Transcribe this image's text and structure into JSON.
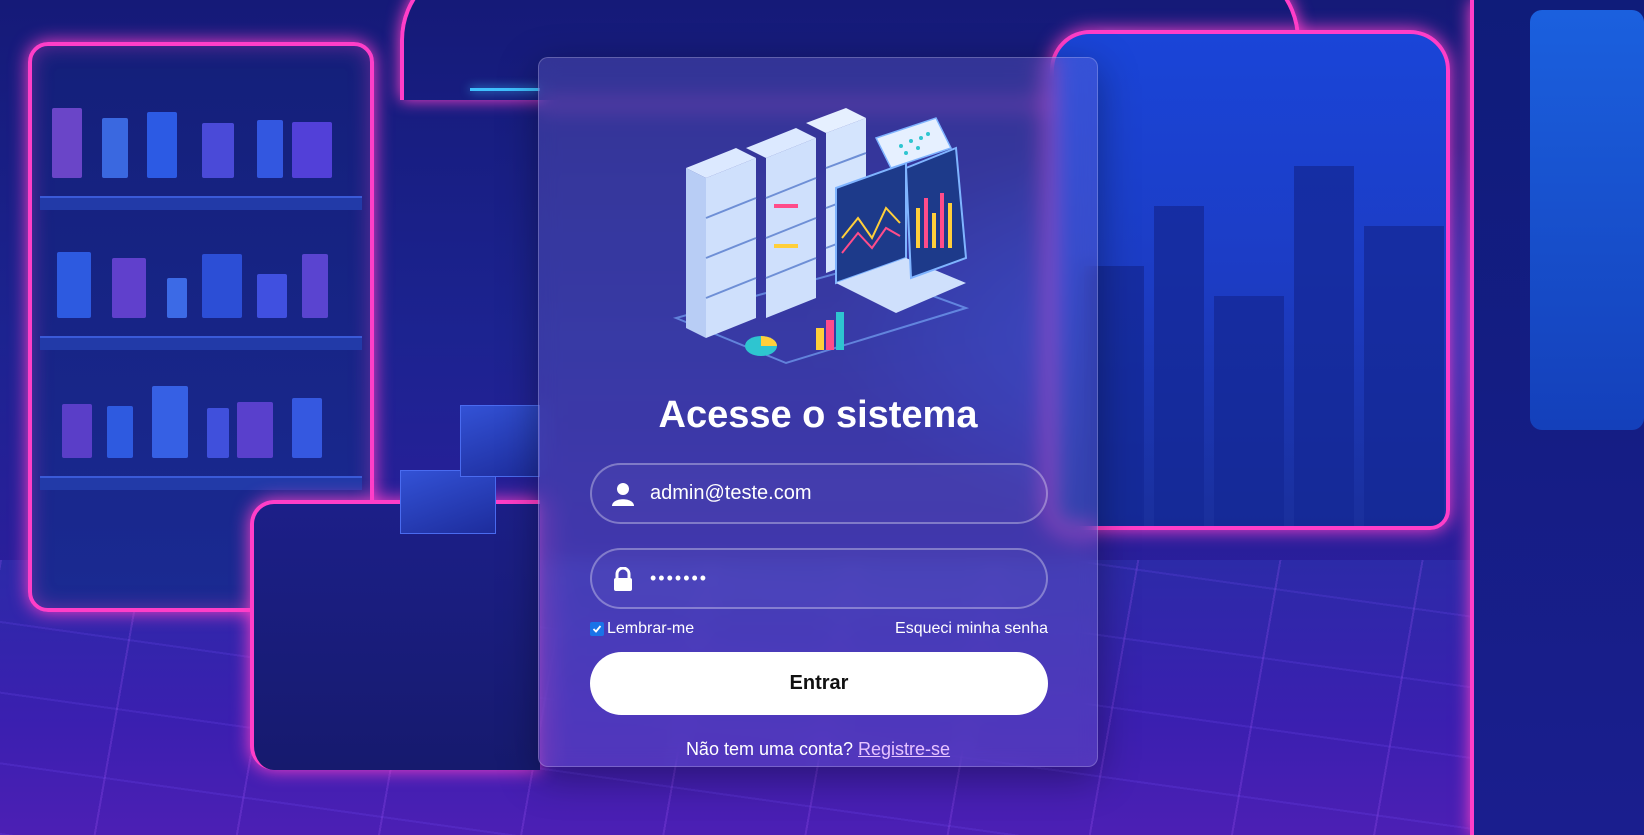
{
  "theme": {
    "accent_neon": "#ff3ec8",
    "button_bg": "#ffffff",
    "link_color": "#e6c3ff"
  },
  "login": {
    "title": "Acesse o sistema",
    "email": {
      "icon": "user-icon",
      "value": "admin@teste.com"
    },
    "password": {
      "icon": "lock-icon",
      "value": "•••••••"
    },
    "remember": {
      "label": "Lembrar-me",
      "checked": true
    },
    "forgot_label": "Esqueci minha senha",
    "submit_label": "Entrar",
    "register_prompt": "Não tem uma conta?",
    "register_link": "Registre-se"
  },
  "illustration": {
    "icon": "server-analytics-illustration"
  }
}
